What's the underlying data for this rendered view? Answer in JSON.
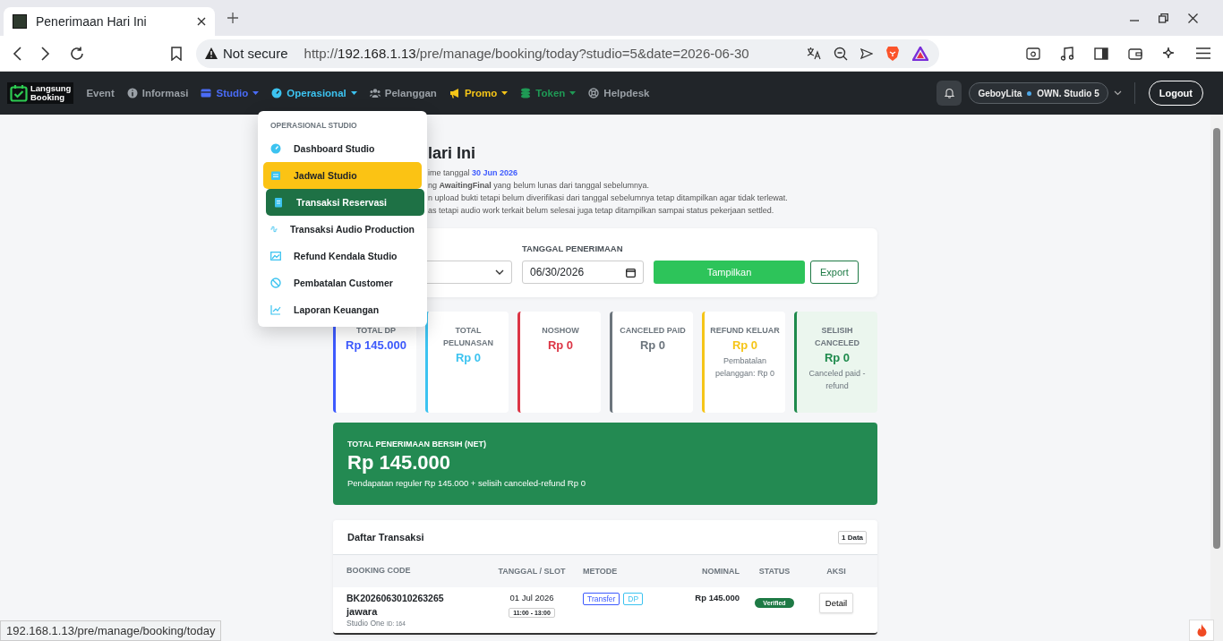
{
  "browser": {
    "tab_title": "Penerimaan Hari Ini",
    "security": "Not secure",
    "url": {
      "scheme": "http://",
      "host": "192.168.1.13",
      "path": "/pre/manage/booking/today?studio=5&date=2026-06-30"
    },
    "status_url": "192.168.1.13/pre/manage/booking/today"
  },
  "navbar": {
    "logo": [
      "Langsung",
      "Booking"
    ],
    "items": [
      {
        "label": "Event",
        "color": "#9aa0a6",
        "dropdown": false
      },
      {
        "label": "Informasi",
        "color": "#9aa0a6",
        "dropdown": false
      },
      {
        "label": "Studio",
        "color": "#4a6cf7",
        "dropdown": true
      },
      {
        "label": "Operasional",
        "color": "#3cc3f0",
        "dropdown": true
      },
      {
        "label": "Pelanggan",
        "color": "#9aa0a6",
        "dropdown": false
      },
      {
        "label": "Promo",
        "color": "#f5c518",
        "dropdown": true
      },
      {
        "label": "Token",
        "color": "#1f9a55",
        "dropdown": true
      },
      {
        "label": "Helpdesk",
        "color": "#9aa0a6",
        "dropdown": false
      }
    ],
    "user": "GeboyLita",
    "role": "OWN. Studio 5",
    "logout": "Logout"
  },
  "menu": {
    "header": "OPERASIONAL STUDIO",
    "items": [
      {
        "label": "Dashboard Studio",
        "selected": false,
        "hovered": false
      },
      {
        "label": "Jadwal Studio",
        "selected": false,
        "hovered": true
      },
      {
        "label": "Transaksi Reservasi",
        "selected": true,
        "hovered": false
      },
      {
        "label": "Transaksi Audio Production",
        "selected": false,
        "hovered": false
      },
      {
        "label": "Refund Kendala Studio",
        "selected": false,
        "hovered": false
      },
      {
        "label": "Pembatalan Customer",
        "selected": false,
        "hovered": false
      },
      {
        "label": "Laporan Keuangan",
        "selected": false,
        "hovered": false
      }
    ]
  },
  "header": {
    "title": "lari Ini",
    "date_prefix": "ime tanggal",
    "date": "30 Jun 2026",
    "notes": [
      "ng **AwaitingFinal** yang belum lunas dari tanggal sebelumnya.",
      "n upload bukti tetapi belum diverifikasi dari tanggal sebelumnya tetap ditampilkan agar tidak terlewat.",
      "as tetapi audio work terkait belum selesai juga tetap ditampilkan sampai status pekerjaan settled."
    ]
  },
  "filter": {
    "date_label": "TANGGAL PENERIMAAN",
    "date": "06/30/2026",
    "submit": "Tampilkan",
    "export": "Export"
  },
  "stats": [
    {
      "label": "TOTAL DP",
      "value": "Rp 145.000",
      "color": "#3d5afe"
    },
    {
      "label": "TOTAL PELUNASAN",
      "value": "Rp 0",
      "color": "#3cc3f0"
    },
    {
      "label": "NOSHOW",
      "value": "Rp 0",
      "color": "#dc3545"
    },
    {
      "label": "CANCELED PAID",
      "value": "Rp 0",
      "color": "#6c757d"
    },
    {
      "label": "REFUND KELUAR",
      "value": "Rp 0",
      "note": "Pembatalan pelanggan: Rp 0",
      "color": "#f5c518"
    },
    {
      "label": "SELISIH CANCELED",
      "value": "Rp 0",
      "note": "Canceled paid - refund",
      "color": "#1e8a4c"
    }
  ],
  "net": {
    "label": "TOTAL PENERIMAAN BERSIH (NET)",
    "value": "Rp 145.000",
    "detail": "Pendapatan reguler Rp 145.000 + selisih canceled-refund Rp 0"
  },
  "table": {
    "title": "Daftar Transaksi",
    "count": "1 Data",
    "columns": [
      "BOOKING CODE",
      "TANGGAL / SLOT",
      "METODE",
      "NOMINAL",
      "STATUS",
      "AKSI"
    ],
    "rows": [
      {
        "code": "BK2026063010263265",
        "customer": "jawara",
        "studio": "Studio One",
        "id": "ID: 164",
        "date": "01 Jul 2026",
        "slot": "11:00 - 13:00",
        "methods": [
          {
            "label": "Transfer",
            "color": "#3d5afe"
          },
          {
            "label": "DP",
            "color": "#3cc3f0"
          }
        ],
        "nominal": "Rp 145.000",
        "status": "Verified",
        "action": "Detail"
      }
    ]
  }
}
